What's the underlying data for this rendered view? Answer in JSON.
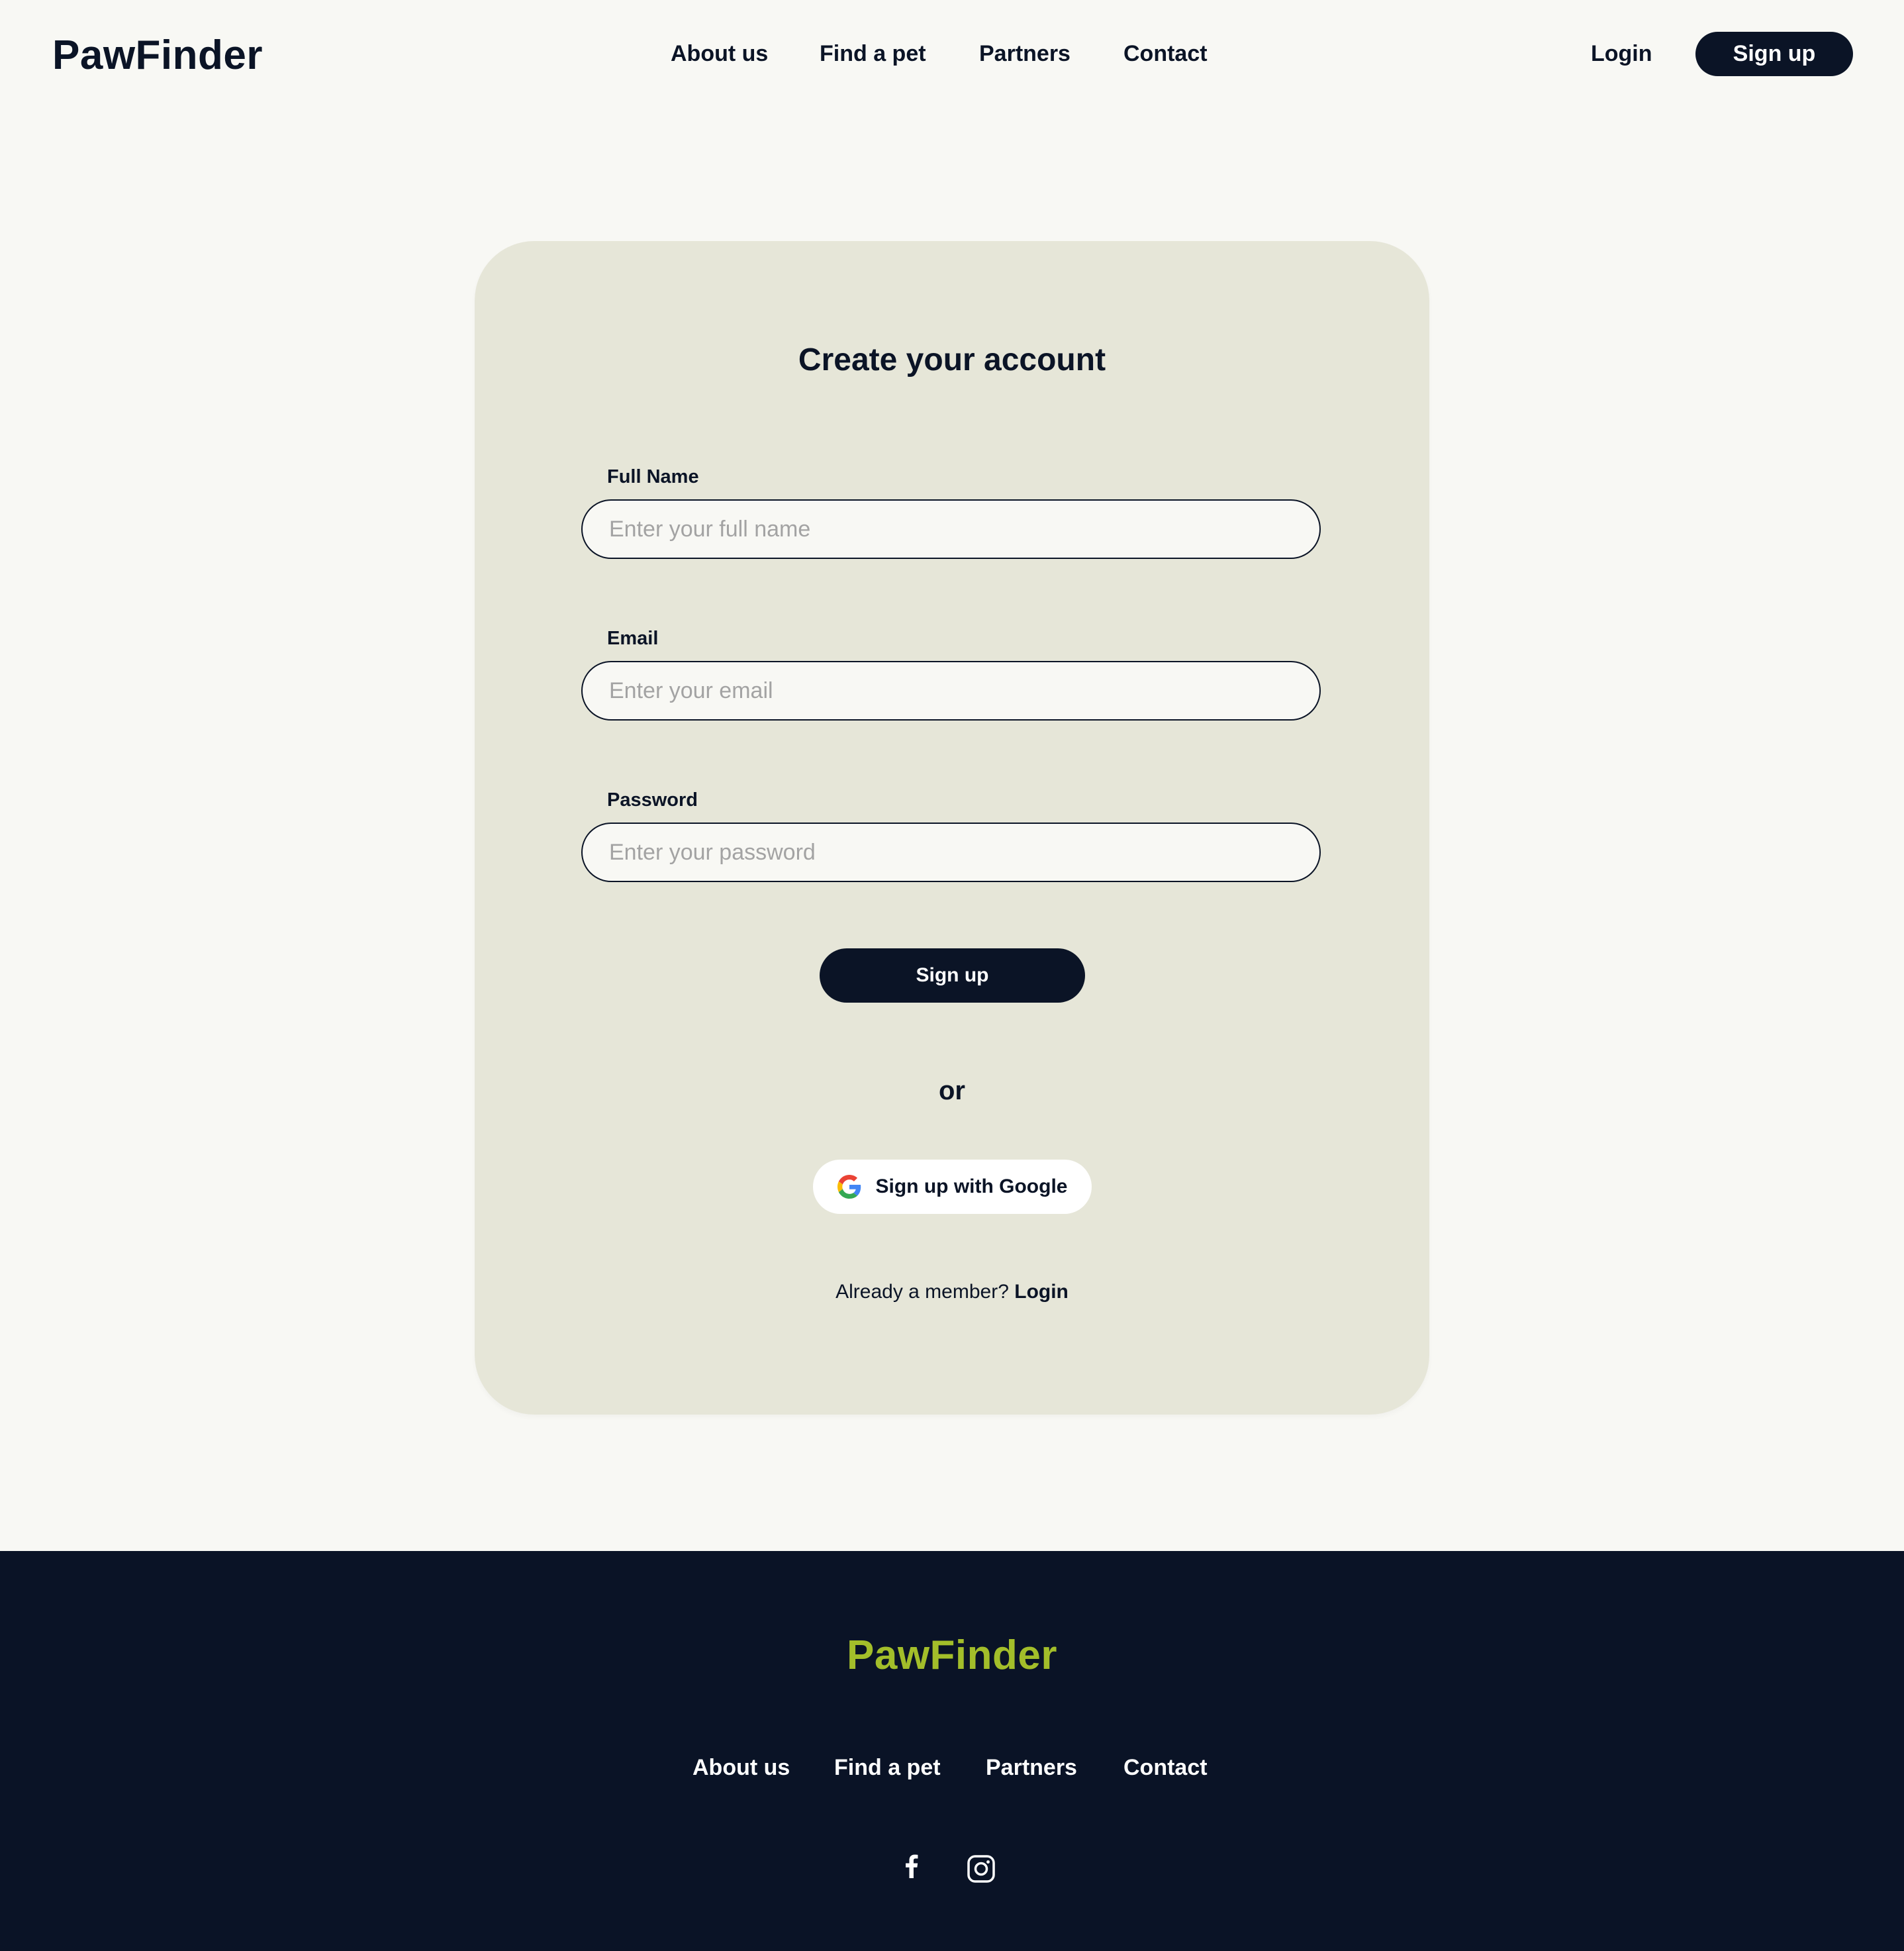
{
  "header": {
    "logo": "PawFinder",
    "nav": [
      "About us",
      "Find a pet",
      "Partners",
      "Contact"
    ],
    "login_label": "Login",
    "signup_label": "Sign up"
  },
  "form": {
    "title": "Create your account",
    "fields": {
      "full_name": {
        "label": "Full Name",
        "placeholder": "Enter your full name",
        "value": ""
      },
      "email": {
        "label": "Email",
        "placeholder": "Enter your email",
        "value": ""
      },
      "password": {
        "label": "Password",
        "placeholder": "Enter your password",
        "value": ""
      }
    },
    "submit_label": "Sign up",
    "divider_text": "or",
    "google_label": "Sign up with Google",
    "member_text": "Already a member?",
    "member_link": "Login"
  },
  "footer": {
    "logo": "PawFinder",
    "nav": [
      "About us",
      "Find a pet",
      "Partners",
      "Contact"
    ],
    "social_icons": [
      "facebook-icon",
      "instagram-icon"
    ]
  },
  "colors": {
    "page_background": "#F8F8F4",
    "card_background": "#E6E6D8",
    "primary_dark": "#0B1426",
    "footer_background": "#0A1326",
    "footer_logo": "#A3BE2A",
    "placeholder_text": "#A3A3A3"
  }
}
